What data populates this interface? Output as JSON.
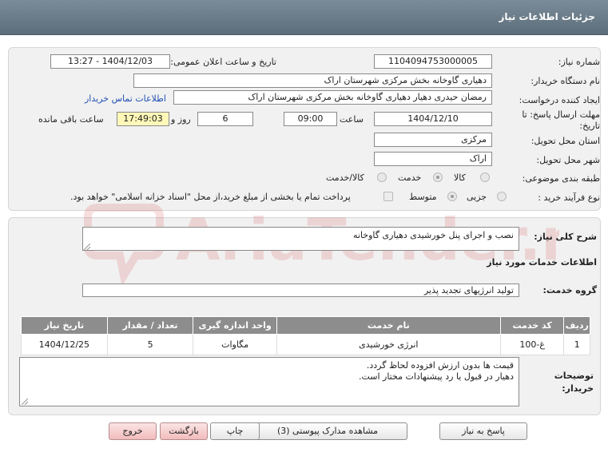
{
  "header": {
    "title": "جزئیات اطلاعات نیاز"
  },
  "form": {
    "need_number": {
      "label": "شماره نیاز:",
      "value": "1104094753000005"
    },
    "announce_datetime": {
      "label": "تاریخ و ساعت اعلان عمومی:",
      "value": "1404/12/03 - 13:27"
    },
    "buyer_org": {
      "label": "نام دستگاه خریدار:",
      "value": "دهیاری گاوخانه بخش مرکزی  شهرستان اراک"
    },
    "requester": {
      "label": "ایجاد کننده درخواست:",
      "value": "رمضان حیدری دهیار دهیاری گاوخانه بخش مرکزی  شهرستان اراک",
      "contact_link": "اطلاعات تماس خریدار"
    },
    "deadline": {
      "label": "مهلت ارسال پاسخ: تا تاریخ:",
      "date": "1404/12/10",
      "time_label": "ساعت",
      "time": "09:00",
      "days": "6",
      "days_label": "روز و",
      "remaining": "17:49:03",
      "remaining_label": "ساعت باقی مانده"
    },
    "province": {
      "label": "استان محل تحویل:",
      "value": "مرکزی"
    },
    "city": {
      "label": "شهر محل تحویل:",
      "value": "اراک"
    },
    "category": {
      "label": "طبقه بندی موضوعی:",
      "options": [
        "کالا",
        "خدمت",
        "کالا/خدمت"
      ],
      "selected": "خدمت"
    },
    "process_type": {
      "label": "نوع فرآیند خرید :",
      "options": [
        "جزیی",
        "متوسط"
      ],
      "selected": "متوسط",
      "payment_note": "پرداخت تمام یا بخشی از مبلغ خرید،از محل \"اسناد خزانه اسلامی\" خواهد بود."
    }
  },
  "description": {
    "label": "شرح کلی نیاز:",
    "value": "نصب و اجرای پنل خورشیدی دهیاری گاوخانه"
  },
  "services": {
    "section_title": "اطلاعات خدمات مورد نیاز",
    "group_label": "گروه خدمت:",
    "group_value": "تولید انرژیهای تجدید پذیر",
    "columns": [
      "ردیف",
      "کد خدمت",
      "نام خدمت",
      "واحد اندازه گیری",
      "تعداد / مقدار",
      "تاریخ نیاز"
    ],
    "rows": [
      [
        "1",
        "غ-100",
        "انرژی خورشیدی",
        "مگاوات",
        "5",
        "1404/12/25"
      ]
    ]
  },
  "buyer_notes": {
    "label": "توضیحات خریدار:",
    "value": "قیمت ها بدون ارزش افزوده لحاظ گردد.\nدهیار در قبول یا رد پیشنهادات مختار است."
  },
  "buttons": {
    "reply": "پاسخ به نیاز",
    "attachments": "مشاهده مدارک پیوستی (3)",
    "print": "چاپ",
    "back": "بازگشت",
    "exit": "خروج"
  },
  "watermark": {
    "text": "AriaTender.net"
  },
  "colors": {
    "header": "#6b7c89",
    "table_header": "#8d8d8d",
    "link": "#1f4fb5",
    "pink_button": "#f2bcbc"
  }
}
